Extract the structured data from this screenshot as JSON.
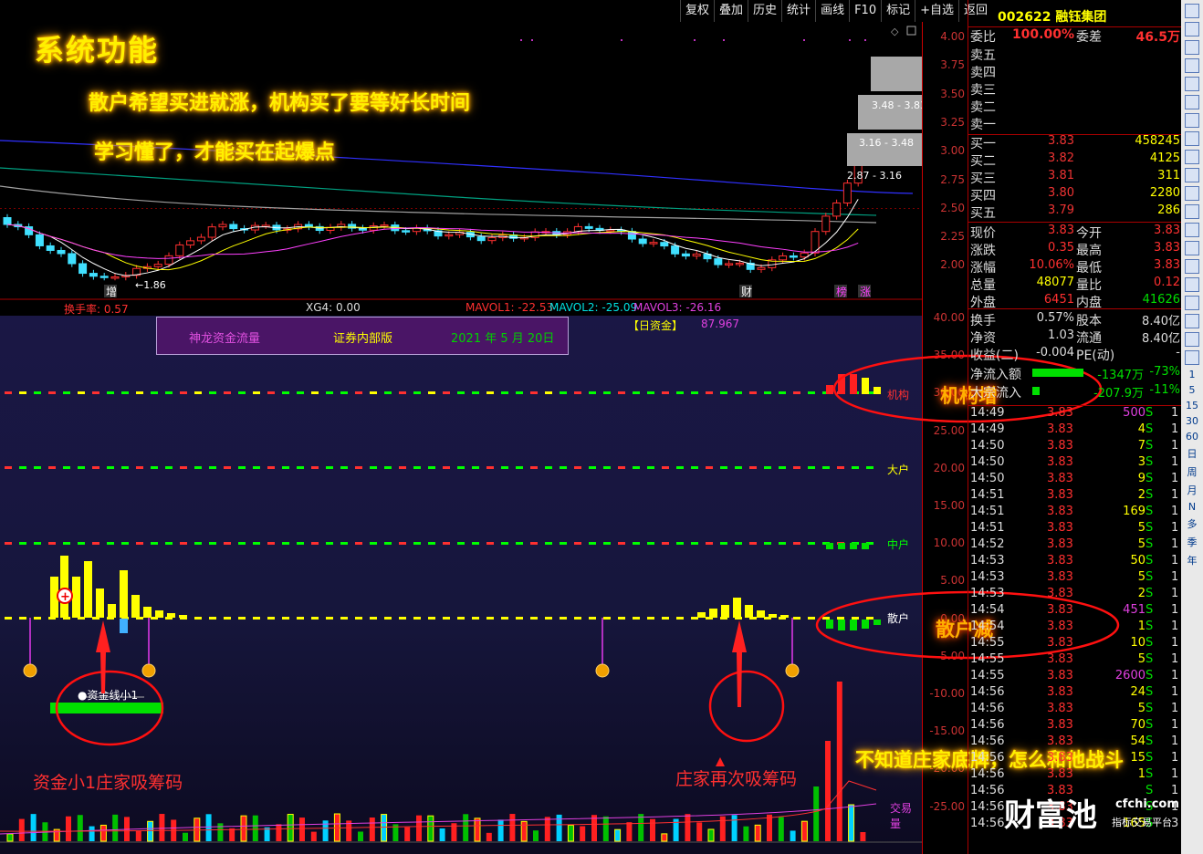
{
  "toolbar": {
    "items": [
      "复权",
      "叠加",
      "历史",
      "统计",
      "画线",
      "F10",
      "标记",
      "+自选",
      "返回"
    ]
  },
  "stock": {
    "code_name": "002622 融钰集团"
  },
  "overlay": {
    "title": "系统功能",
    "line1": "散户希望买进就涨，机构买了要等好长时间",
    "line2": "学习懂了，才能买在起爆点",
    "jigou": "机构增",
    "sanhu": "散户减",
    "fight": "不知道庄家底牌，怎么和他战斗",
    "xi1": "资金小1庄家吸筹码",
    "xi2": "庄家再次吸筹码",
    "zijin_label": "●资金线小1"
  },
  "kline": {
    "range_labels": [
      "3.48 - 3.83",
      "3.16 - 3.48",
      "2.87 - 3.16"
    ],
    "low_label": "1.86",
    "markers": [
      "增",
      "财",
      "榜",
      "涨"
    ],
    "y_ticks": [
      "4.00",
      "3.75",
      "3.50",
      "3.25",
      "3.00",
      "2.75",
      "2.50",
      "2.25",
      "2.00"
    ]
  },
  "indicator_bar": {
    "turnover": "换手率: 0.57",
    "xg4": "XG4: 0.00",
    "mavol1": "MAVOL1: -22.53",
    "mavol2": "MAVOL2: -25.09",
    "mavol3": "MAVOL3: -26.16"
  },
  "fund": {
    "box_title": "神龙资金流量",
    "box_edition": "证券内部版",
    "box_date": "2021 年 5 月 20日",
    "day_fund_label": "【日资金】",
    "day_fund_value": "87.967",
    "lines": [
      "机构",
      "大户",
      "中户",
      "散户"
    ],
    "volume_label": "交易量",
    "y_ticks": [
      "40.00",
      "35.00",
      "30.00",
      "25.00",
      "20.00",
      "15.00",
      "10.00",
      "5.00",
      "0.00",
      "-5.00",
      "-10.00",
      "-15.00",
      "-20.00",
      "-25.00"
    ]
  },
  "quote": {
    "weibi": {
      "label": "委比",
      "value": "100.00%",
      "label2": "委差",
      "value2": "46.5万"
    },
    "sell": [
      {
        "label": "卖五"
      },
      {
        "label": "卖四"
      },
      {
        "label": "卖三"
      },
      {
        "label": "卖二"
      },
      {
        "label": "卖一"
      }
    ],
    "buy": [
      {
        "label": "买一",
        "price": "3.83",
        "vol": "458245"
      },
      {
        "label": "买二",
        "price": "3.82",
        "vol": "4125"
      },
      {
        "label": "买三",
        "price": "3.81",
        "vol": "311"
      },
      {
        "label": "买四",
        "price": "3.80",
        "vol": "2280"
      },
      {
        "label": "买五",
        "price": "3.79",
        "vol": "286"
      }
    ],
    "stats": [
      {
        "l1": "现价",
        "v1": "3.83",
        "l2": "今开",
        "v2": "3.83"
      },
      {
        "l1": "涨跌",
        "v1": "0.35",
        "l2": "最高",
        "v2": "3.83"
      },
      {
        "l1": "涨幅",
        "v1": "10.06%",
        "l2": "最低",
        "v2": "3.83"
      },
      {
        "l1": "总量",
        "v1": "48077",
        "l2": "量比",
        "v2": "0.12"
      },
      {
        "l1": "外盘",
        "v1": "6451",
        "l2": "内盘",
        "v2": "41626"
      }
    ],
    "stats2": [
      {
        "l1": "换手",
        "v1": "0.57%",
        "l2": "股本",
        "v2": "8.40亿"
      },
      {
        "l1": "净资",
        "v1": "1.03",
        "l2": "流通",
        "v2": "8.40亿"
      },
      {
        "l1": "收益(二)",
        "v1": "-0.004",
        "l2": "PE(动)",
        "v2": "-"
      }
    ],
    "netflow": [
      {
        "label": "净流入额",
        "v1": "-1347万",
        "v2": "-73%"
      },
      {
        "label": "大宗流入",
        "v1": "-207.9万",
        "v2": "-11%"
      }
    ],
    "ticks": [
      {
        "t": "14:49",
        "p": "3.83",
        "v": "500",
        "s": "S",
        "n": "1"
      },
      {
        "t": "14:49",
        "p": "3.83",
        "v": "4",
        "s": "S",
        "n": "1"
      },
      {
        "t": "14:50",
        "p": "3.83",
        "v": "7",
        "s": "S",
        "n": "1"
      },
      {
        "t": "14:50",
        "p": "3.83",
        "v": "3",
        "s": "S",
        "n": "1"
      },
      {
        "t": "14:50",
        "p": "3.83",
        "v": "9",
        "s": "S",
        "n": "1"
      },
      {
        "t": "14:51",
        "p": "3.83",
        "v": "2",
        "s": "S",
        "n": "1"
      },
      {
        "t": "14:51",
        "p": "3.83",
        "v": "169",
        "s": "S",
        "n": "1"
      },
      {
        "t": "14:51",
        "p": "3.83",
        "v": "5",
        "s": "S",
        "n": "1"
      },
      {
        "t": "14:52",
        "p": "3.83",
        "v": "5",
        "s": "S",
        "n": "1"
      },
      {
        "t": "14:53",
        "p": "3.83",
        "v": "50",
        "s": "S",
        "n": "1"
      },
      {
        "t": "14:53",
        "p": "3.83",
        "v": "5",
        "s": "S",
        "n": "1"
      },
      {
        "t": "14:53",
        "p": "3.83",
        "v": "2",
        "s": "S",
        "n": "1"
      },
      {
        "t": "14:54",
        "p": "3.83",
        "v": "451",
        "s": "S",
        "n": "1"
      },
      {
        "t": "14:54",
        "p": "3.83",
        "v": "1",
        "s": "S",
        "n": "1"
      },
      {
        "t": "14:55",
        "p": "3.83",
        "v": "10",
        "s": "S",
        "n": "1"
      },
      {
        "t": "14:55",
        "p": "3.83",
        "v": "5",
        "s": "S",
        "n": "1"
      },
      {
        "t": "14:55",
        "p": "3.83",
        "v": "2600",
        "s": "S",
        "n": "1"
      },
      {
        "t": "14:56",
        "p": "3.83",
        "v": "24",
        "s": "S",
        "n": "1"
      },
      {
        "t": "14:56",
        "p": "3.83",
        "v": "5",
        "s": "S",
        "n": "1"
      },
      {
        "t": "14:56",
        "p": "3.83",
        "v": "70",
        "s": "S",
        "n": "1"
      },
      {
        "t": "14:56",
        "p": "3.83",
        "v": "54",
        "s": "S",
        "n": "1"
      },
      {
        "t": "14:56",
        "p": "3.83",
        "v": "15",
        "s": "S",
        "n": "1"
      },
      {
        "t": "14:56",
        "p": "3.83",
        "v": "1",
        "s": "S",
        "n": "1"
      },
      {
        "t": "14:56",
        "p": "3.83",
        "v": "",
        "s": "S",
        "n": "1"
      },
      {
        "t": "14:56",
        "p": "3.83",
        "v": "",
        "s": "S",
        "n": "1"
      },
      {
        "t": "14:56",
        "p": "3.83",
        "v": "165",
        "s": "S",
        "n": "3"
      }
    ]
  },
  "watermark": {
    "cn": "财富池",
    "url": "cfchi.com",
    "sub": "指标交易平台"
  },
  "sidebar": {
    "texts": [
      "1",
      "5",
      "15",
      "30",
      "60",
      "日",
      "周",
      "月",
      "N",
      "多",
      "季",
      "年"
    ]
  },
  "colors": {
    "red": "#ff3030",
    "green": "#00e000",
    "yellow": "#ffff00",
    "cyan": "#40e0ff",
    "bg": "#000000"
  }
}
